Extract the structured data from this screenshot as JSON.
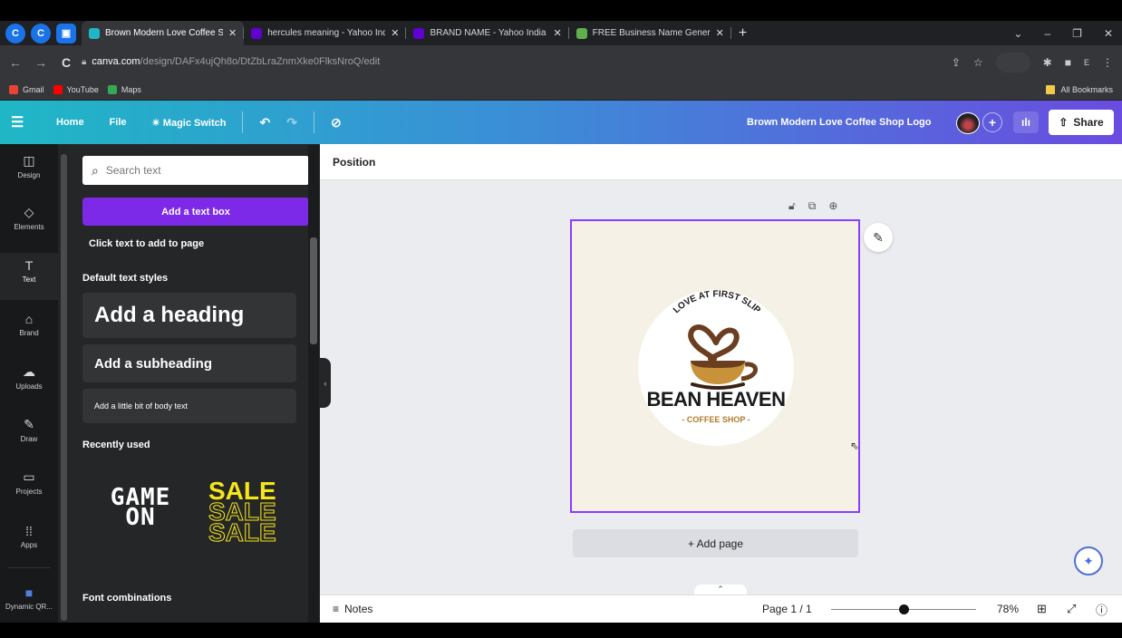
{
  "browser": {
    "tabs": [
      {
        "title": "Brown Modern Love Coffee Sho",
        "active": true,
        "favicon_color": "#1fb7c6"
      },
      {
        "title": "hercules meaning - Yahoo India",
        "active": false,
        "favicon_color": "#6001d2"
      },
      {
        "title": "BRAND NAME - Yahoo India Se",
        "active": false,
        "favicon_color": "#6001d2"
      },
      {
        "title": "FREE Business Name Generator",
        "active": false,
        "favicon_color": "#5fb04c"
      }
    ],
    "url_host": "canva.com",
    "url_path": "/design/DAFx4ujQh8o/DtZbLraZnmXke0FlksNroQ/edit",
    "bookmarks": [
      {
        "label": "Gmail",
        "color": "#ea4335"
      },
      {
        "label": "YouTube",
        "color": "#ff0000"
      },
      {
        "label": "Maps",
        "color": "#34a853"
      }
    ],
    "all_bookmarks": "All Bookmarks"
  },
  "header": {
    "home": "Home",
    "file": "File",
    "magic_switch": "Magic Switch",
    "doc_title": "Brown Modern Love Coffee Shop Logo",
    "share": "Share"
  },
  "rail": {
    "items": [
      {
        "label": "Design",
        "icon": "layout-icon"
      },
      {
        "label": "Elements",
        "icon": "shapes-icon"
      },
      {
        "label": "Text",
        "icon": "text-icon"
      },
      {
        "label": "Brand",
        "icon": "brand-icon"
      },
      {
        "label": "Uploads",
        "icon": "cloud-upload-icon"
      },
      {
        "label": "Draw",
        "icon": "pen-icon"
      },
      {
        "label": "Projects",
        "icon": "folder-icon"
      },
      {
        "label": "Apps",
        "icon": "apps-grid-icon"
      },
      {
        "label": "Dynamic QR...",
        "icon": "qr-app-icon"
      }
    ]
  },
  "panel": {
    "search_placeholder": "Search text",
    "add_text_box": "Add a text box",
    "click_text_hint": "Click text to add to page",
    "default_styles_heading": "Default text styles",
    "heading_sample": "Add a heading",
    "subheading_sample": "Add a subheading",
    "body_sample": "Add a little bit of body text",
    "recently_used": "Recently used",
    "recent_game_line1": "GAME",
    "recent_game_line2": "ON",
    "recent_sale": "SALE",
    "font_combinations": "Font combinations"
  },
  "editor": {
    "position": "Position",
    "logo_arc_text": "LOVE AT FIRST SLIP",
    "logo_name": "BEAN HEAVEN",
    "logo_sub": "- COFFEE SHOP -",
    "add_page": "+ Add page"
  },
  "status": {
    "notes": "Notes",
    "page": "Page 1 / 1",
    "zoom": "78%",
    "zoom_level_percent": 78
  },
  "colors": {
    "accent_purple": "#7d2ae8",
    "selection": "#8b3dff",
    "coffee_brown": "#6b3e1f"
  }
}
